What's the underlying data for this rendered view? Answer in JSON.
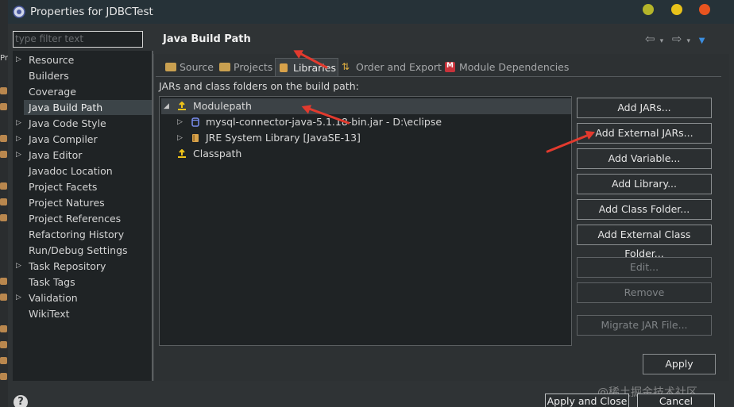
{
  "window": {
    "title": "Properties for JDBCTest",
    "controls": [
      {
        "name": "minimize",
        "color": "#b5b52a"
      },
      {
        "name": "maximize",
        "color": "#e8c21a"
      },
      {
        "name": "close",
        "color": "#e8541f"
      }
    ]
  },
  "gutter": {
    "label": "Pr"
  },
  "filter": {
    "placeholder": "type filter text"
  },
  "sidebar": {
    "items": [
      {
        "label": "Resource",
        "expandable": true
      },
      {
        "label": "Builders",
        "expandable": false
      },
      {
        "label": "Coverage",
        "expandable": false
      },
      {
        "label": "Java Build Path",
        "expandable": false,
        "selected": true
      },
      {
        "label": "Java Code Style",
        "expandable": true
      },
      {
        "label": "Java Compiler",
        "expandable": true
      },
      {
        "label": "Java Editor",
        "expandable": true
      },
      {
        "label": "Javadoc Location",
        "expandable": false
      },
      {
        "label": "Project Facets",
        "expandable": false
      },
      {
        "label": "Project Natures",
        "expandable": false
      },
      {
        "label": "Project References",
        "expandable": false
      },
      {
        "label": "Refactoring History",
        "expandable": false
      },
      {
        "label": "Run/Debug Settings",
        "expandable": false
      },
      {
        "label": "Task Repository",
        "expandable": true
      },
      {
        "label": "Task Tags",
        "expandable": false
      },
      {
        "label": "Validation",
        "expandable": true
      },
      {
        "label": "WikiText",
        "expandable": false
      }
    ]
  },
  "main": {
    "title": "Java Build Path",
    "tabs": [
      {
        "label": "Source",
        "icon": "source-folder-icon"
      },
      {
        "label": "Projects",
        "icon": "projects-folder-icon"
      },
      {
        "label": "Libraries",
        "icon": "libraries-icon",
        "active": true
      },
      {
        "label": "Order and Export",
        "icon": "order-arrows-icon"
      },
      {
        "label": "Module Dependencies",
        "icon": "module-m-icon"
      }
    ],
    "jars_label": "JARs and class folders on the build path:",
    "build_tree": [
      {
        "label": "Modulepath",
        "icon": "modulepath-icon",
        "twisty": "◢",
        "level": 0
      },
      {
        "label": "mysql-connector-java-5.1.18-bin.jar - D:\\eclipse",
        "icon": "jar-icon",
        "twisty": "▷",
        "level": 1
      },
      {
        "label": "JRE System Library [JavaSE-13]",
        "icon": "library-icon",
        "twisty": "▷",
        "level": 1
      },
      {
        "label": "Classpath",
        "icon": "classpath-icon",
        "twisty": "",
        "level": 0
      }
    ],
    "buttons": {
      "add_jars": "Add JARs...",
      "add_external_jars": "Add External JARs...",
      "add_variable": "Add Variable...",
      "add_library": "Add Library...",
      "add_class_folder": "Add Class Folder...",
      "add_external_class_folder": "Add External Class Folder...",
      "edit": "Edit...",
      "remove": "Remove",
      "migrate_jar": "Migrate JAR File...",
      "apply": "Apply"
    }
  },
  "footer": {
    "help": "?",
    "apply_close": "Apply and Close",
    "cancel": "Cancel"
  },
  "watermark": "@稀土掘金技术社区"
}
